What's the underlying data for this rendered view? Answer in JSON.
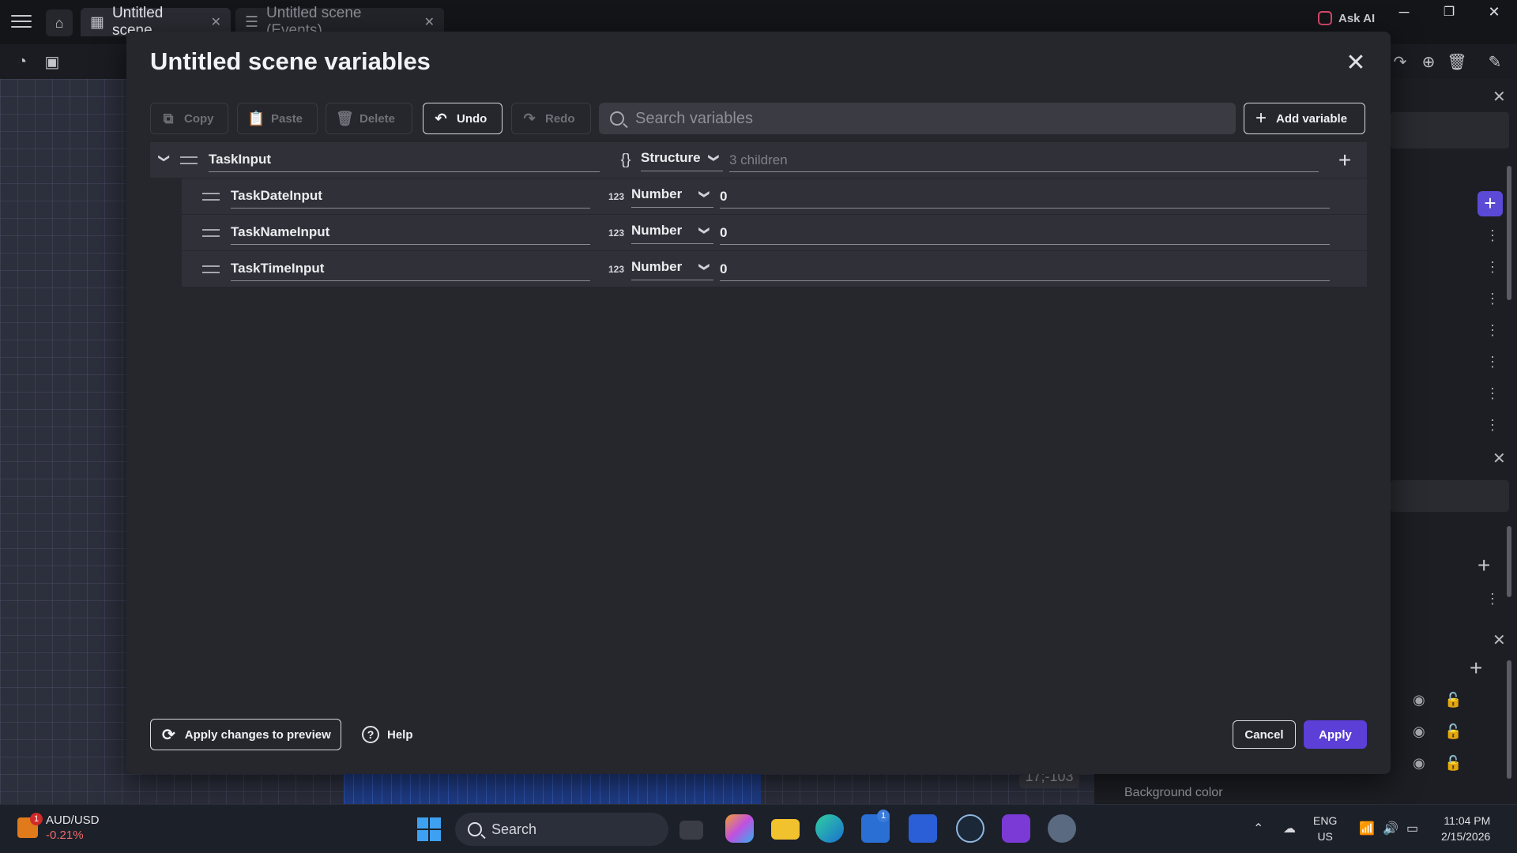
{
  "titlebar": {
    "tabs": [
      {
        "label": "Untitled scene",
        "active": true
      },
      {
        "label": "Untitled scene (Events)",
        "active": false
      }
    ],
    "ask_ai": "Ask AI",
    "window_controls": [
      "─",
      "❐",
      "✕"
    ]
  },
  "canvas": {
    "coordinate_readout": "17;-103"
  },
  "right_panel": {
    "background_color_label": "Background color"
  },
  "dialog": {
    "title": "Untitled scene variables",
    "toolbar": {
      "copy": "Copy",
      "paste": "Paste",
      "delete": "Delete",
      "undo": "Undo",
      "redo": "Redo",
      "add_variable": "Add variable"
    },
    "search": {
      "placeholder": "Search variables",
      "value": ""
    },
    "variables": [
      {
        "name": "TaskInput",
        "type": "Structure",
        "value": "3 children",
        "expanded": true
      },
      {
        "name": "TaskDateInput",
        "type": "Number",
        "value": "0"
      },
      {
        "name": "TaskNameInput",
        "type": "Number",
        "value": "0"
      },
      {
        "name": "TaskTimeInput",
        "type": "Number",
        "value": "0"
      }
    ],
    "type_icons": {
      "structure": "{}",
      "number": "123"
    },
    "footer": {
      "apply_preview": "Apply changes to preview",
      "help": "Help",
      "cancel": "Cancel",
      "apply": "Apply"
    },
    "accent_color": "#5b3fd6"
  },
  "taskbar": {
    "ticker": {
      "symbol": "AUD/USD",
      "change": "-0.21%",
      "badge": "1"
    },
    "search_label": "Search",
    "store_badge": "1",
    "language": {
      "lang": "ENG",
      "region": "US"
    },
    "clock": {
      "time": "11:04 PM",
      "date": "2/15/2026"
    }
  }
}
